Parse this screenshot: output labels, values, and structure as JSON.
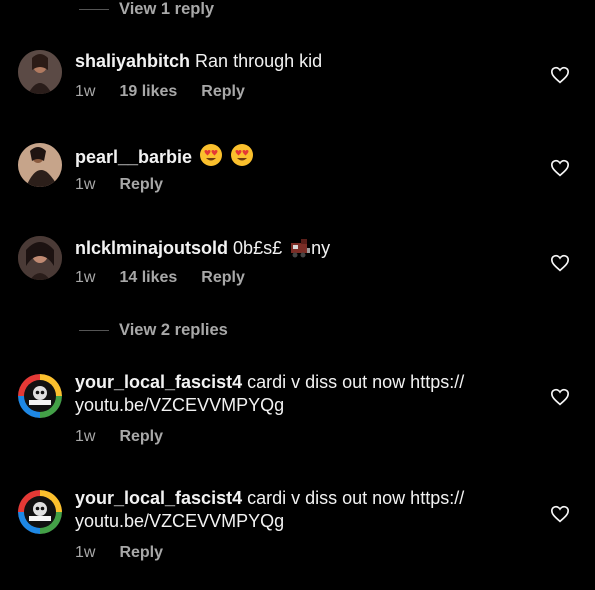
{
  "top_thread": {
    "label": "View 1 reply"
  },
  "comments": [
    {
      "username": "shaliyahbitch",
      "text": "Ran through kid",
      "age": "1w",
      "likes": "19 likes",
      "reply": "Reply"
    },
    {
      "username": "pearl__barbie",
      "text": "",
      "emoji": [
        "heart-eyes-emoji",
        "heart-eyes-emoji"
      ],
      "age": "1w",
      "reply": "Reply"
    },
    {
      "username": "nlcklminajoutsold",
      "text_before": "0b£s£",
      "text_after": "ny",
      "emoji": [
        "train-emoji"
      ],
      "age": "1w",
      "likes": "14 likes",
      "reply": "Reply"
    },
    {
      "username": "your_local_fascist4",
      "text_line1": "cardi v diss out now https://",
      "text_line2": "youtu.be/VZCEVVMPYQg",
      "age": "1w",
      "reply": "Reply"
    },
    {
      "username": "your_local_fascist4",
      "text_line1": "cardi v diss out now https://",
      "text_line2": "youtu.be/VZCEVVMPYQg",
      "age": "1w",
      "reply": "Reply"
    }
  ],
  "mid_thread": {
    "label": "View 2 replies"
  },
  "colors": {
    "background": "#000000",
    "text": "#f5f5f5",
    "secondary": "#a8a8a8",
    "divider": "#555555"
  }
}
